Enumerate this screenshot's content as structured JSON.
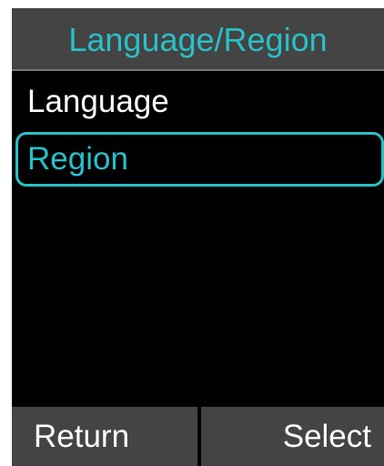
{
  "header": {
    "title": "Language/Region"
  },
  "menu": {
    "items": [
      {
        "label": "Language",
        "selected": false
      },
      {
        "label": "Region",
        "selected": true
      }
    ]
  },
  "softkeys": {
    "left_label": "Return",
    "right_label": "Select"
  },
  "colors": {
    "accent": "#29c0c8",
    "header_bg": "#444444",
    "body_bg": "#000000",
    "text": "#ffffff"
  }
}
